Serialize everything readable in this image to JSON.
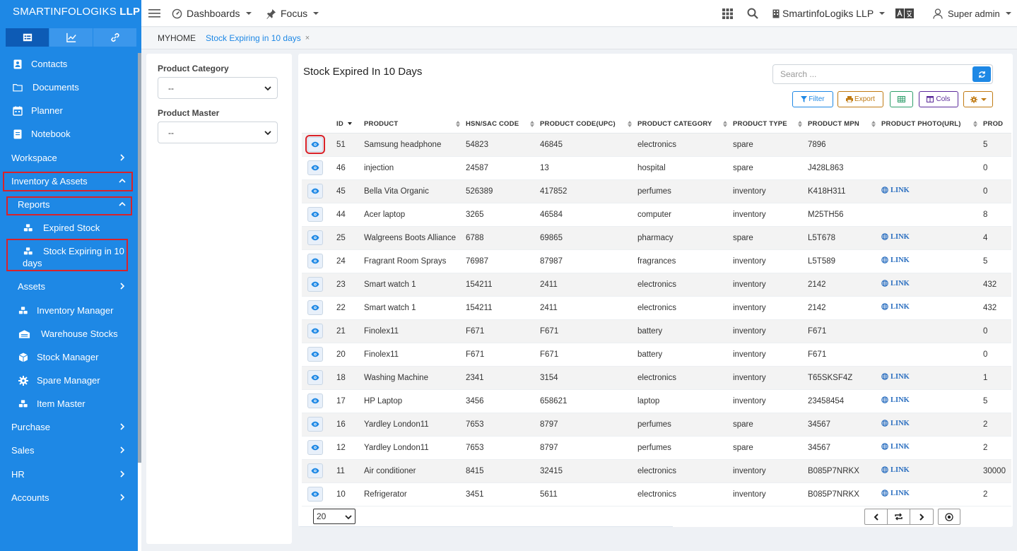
{
  "brand": {
    "name_light": "SMARTINFOLOGIKS",
    "name_bold": "LLP"
  },
  "sidebar": {
    "tabs": [
      {
        "icon": "table-icon",
        "active": true
      },
      {
        "icon": "chart-icon",
        "active": false
      },
      {
        "icon": "link-icon",
        "active": false
      }
    ],
    "items": [
      {
        "label": "Contacts",
        "icon": "contact-icon"
      },
      {
        "label": "Documents",
        "icon": "folder-icon"
      },
      {
        "label": "Planner",
        "icon": "calendar-icon"
      },
      {
        "label": "Notebook",
        "icon": "notebook-icon"
      },
      {
        "label": "Workspace",
        "chevron": "right"
      },
      {
        "label": "Inventory & Assets",
        "chevron": "up"
      },
      {
        "label": "Reports",
        "chevron": "up"
      },
      {
        "label": "Expired Stock",
        "icon": "boxes-icon"
      },
      {
        "label": "Stock Expiring in 10",
        "label2": "days",
        "icon": "boxes-icon"
      },
      {
        "label": "Assets",
        "chevron": "right"
      },
      {
        "label": "Inventory Manager",
        "icon": "boxes-icon"
      },
      {
        "label": "Warehouse Stocks",
        "icon": "warehouse-icon"
      },
      {
        "label": "Stock Manager",
        "icon": "box-icon"
      },
      {
        "label": "Spare Manager",
        "icon": "gear-icon"
      },
      {
        "label": "Item Master",
        "icon": "boxes-icon"
      },
      {
        "label": "Purchase",
        "chevron": "right"
      },
      {
        "label": "Sales",
        "chevron": "right"
      },
      {
        "label": "HR",
        "chevron": "right"
      },
      {
        "label": "Accounts",
        "chevron": "right"
      }
    ]
  },
  "topbar": {
    "dashboards": "Dashboards",
    "focus": "Focus",
    "company": "SmartinfoLogiks LLP",
    "user": "Super admin"
  },
  "breadcrumb": {
    "home": "MYHOME",
    "active": "Stock Expiring in 10 days",
    "close": "×"
  },
  "filters": {
    "category_label": "Product Category",
    "category_value": "--",
    "master_label": "Product Master",
    "master_value": "--"
  },
  "main": {
    "title": "Stock Expired In 10 Days",
    "search_placeholder": "Search ...",
    "buttons": {
      "filter": "Filter",
      "export": "Export",
      "cols": "Cols"
    }
  },
  "table": {
    "columns": [
      "ID",
      "PRODUCT",
      "HSN/SAC CODE",
      "PRODUCT CODE(UPC)",
      "PRODUCT CATEGORY",
      "PRODUCT TYPE",
      "PRODUCT MPN",
      "PRODUCT PHOTO(URL)",
      "PROD"
    ],
    "link_text": "LINK",
    "rows": [
      {
        "id": "51",
        "product": "Samsung headphone",
        "hsn": "54823",
        "upc": "46845",
        "category": "electronics",
        "type": "spare",
        "mpn": "7896",
        "link": false,
        "prod": "5"
      },
      {
        "id": "46",
        "product": "injection",
        "hsn": "24587",
        "upc": "13",
        "category": "hospital",
        "type": "spare",
        "mpn": "J428L863",
        "link": false,
        "prod": "0"
      },
      {
        "id": "45",
        "product": "Bella Vita Organic",
        "hsn": "526389",
        "upc": "417852",
        "category": "perfumes",
        "type": "inventory",
        "mpn": "K418H311",
        "link": true,
        "prod": "0"
      },
      {
        "id": "44",
        "product": "Acer laptop",
        "hsn": "3265",
        "upc": "46584",
        "category": "computer",
        "type": "inventory",
        "mpn": "M25TH56",
        "link": false,
        "prod": "8"
      },
      {
        "id": "25",
        "product": "Walgreens Boots Alliance",
        "hsn": "6788",
        "upc": "69865",
        "category": "pharmacy",
        "type": "spare",
        "mpn": "L5T678",
        "link": true,
        "prod": "4"
      },
      {
        "id": "24",
        "product": "Fragrant Room Sprays",
        "hsn": "76987",
        "upc": "87987",
        "category": "fragrances",
        "type": "inventory",
        "mpn": "L5T589",
        "link": true,
        "prod": "5"
      },
      {
        "id": "23",
        "product": "Smart watch 1",
        "hsn": "154211",
        "upc": "2411",
        "category": "electronics",
        "type": "inventory",
        "mpn": "2142",
        "link": true,
        "prod": "432"
      },
      {
        "id": "22",
        "product": "Smart watch 1",
        "hsn": "154211",
        "upc": "2411",
        "category": "electronics",
        "type": "inventory",
        "mpn": "2142",
        "link": true,
        "prod": "432"
      },
      {
        "id": "21",
        "product": "Finolex11",
        "hsn": "F671",
        "upc": "F671",
        "category": "battery",
        "type": "inventory",
        "mpn": "F671",
        "link": false,
        "prod": "0"
      },
      {
        "id": "20",
        "product": "Finolex11",
        "hsn": "F671",
        "upc": "F671",
        "category": "battery",
        "type": "inventory",
        "mpn": "F671",
        "link": false,
        "prod": "0"
      },
      {
        "id": "18",
        "product": "Washing Machine",
        "hsn": "2341",
        "upc": "3154",
        "category": "electronics",
        "type": "inventory",
        "mpn": "T65SKSF4Z",
        "link": true,
        "prod": "1"
      },
      {
        "id": "17",
        "product": "HP Laptop",
        "hsn": "3456",
        "upc": "658621",
        "category": "laptop",
        "type": "inventory",
        "mpn": "23458454",
        "link": true,
        "prod": "5"
      },
      {
        "id": "16",
        "product": "Yardley London11",
        "hsn": "7653",
        "upc": "8797",
        "category": "perfumes",
        "type": "spare",
        "mpn": "34567",
        "link": true,
        "prod": "2"
      },
      {
        "id": "12",
        "product": "Yardley London11",
        "hsn": "7653",
        "upc": "8797",
        "category": "perfumes",
        "type": "spare",
        "mpn": "34567",
        "link": true,
        "prod": "2"
      },
      {
        "id": "11",
        "product": "Air conditioner",
        "hsn": "8415",
        "upc": "32415",
        "category": "electronics",
        "type": "inventory",
        "mpn": "B085P7NRKX",
        "link": true,
        "prod": "30000"
      },
      {
        "id": "10",
        "product": "Refrigerator",
        "hsn": "3451",
        "upc": "5611",
        "category": "electronics",
        "type": "inventory",
        "mpn": "B085P7NRKX",
        "link": true,
        "prod": "2"
      }
    ]
  },
  "pagination": {
    "page_size": "20"
  },
  "colors": {
    "sidebar": "#1e88e5",
    "accent": "#1e88e5",
    "highlight": "#d9222a",
    "export": "#c07a12",
    "cols": "#5b2a9a",
    "green": "#2e9e6a"
  }
}
